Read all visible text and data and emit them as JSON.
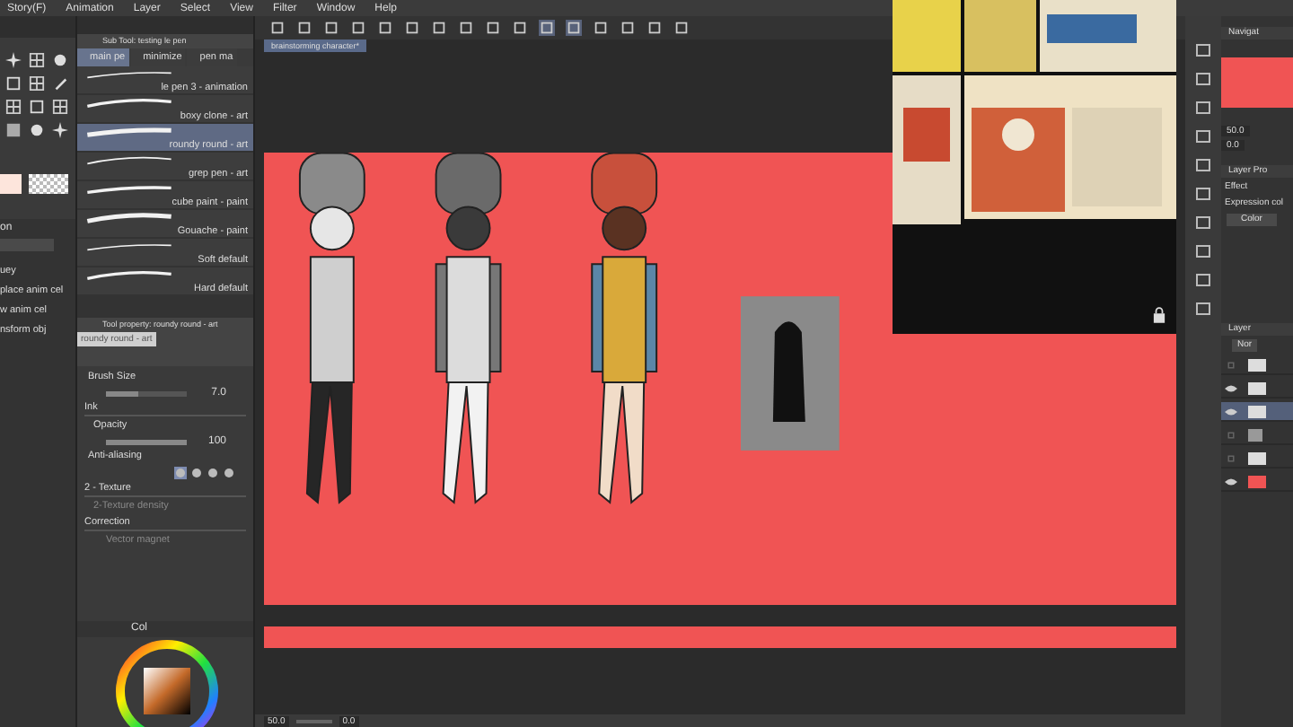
{
  "menu": [
    "Story(F)",
    "Animation",
    "Layer",
    "Select",
    "View",
    "Filter",
    "Window",
    "Help"
  ],
  "left_panel": {
    "header": "on",
    "items": [
      "uey",
      "place anim cel",
      "w anim cel",
      "nsform obj"
    ]
  },
  "sub_tool": {
    "title": "Sub Tool: testing le pen",
    "tabs": [
      {
        "label": "main pe",
        "selected": true
      },
      {
        "label": "minimize",
        "selected": false
      },
      {
        "label": "pen ma",
        "selected": false
      }
    ],
    "brushes": [
      {
        "label": "le pen 3 - animation",
        "selected": false
      },
      {
        "label": "boxy clone - art",
        "selected": false
      },
      {
        "label": "roundy round - art",
        "selected": true
      },
      {
        "label": "grep pen - art",
        "selected": false
      },
      {
        "label": "cube paint - paint",
        "selected": false
      },
      {
        "label": "Gouache - paint",
        "selected": false
      },
      {
        "label": "Soft default",
        "selected": false
      },
      {
        "label": "Hard default",
        "selected": false
      }
    ]
  },
  "tool_property": {
    "title": "Tool property: roundy round - art",
    "preview_label": "roundy round - art",
    "brush_size": {
      "label": "Brush Size",
      "value": "7.0",
      "level": 0.4
    },
    "ink": "Ink",
    "opacity": {
      "label": "Opacity",
      "value": "100",
      "level": 1
    },
    "anti_aliasing": {
      "label": "Anti-aliasing",
      "options": [
        {
          "selected": true
        },
        {
          "selected": false
        },
        {
          "selected": false
        },
        {
          "selected": false
        }
      ]
    },
    "texture": {
      "label": "2 - Texture",
      "density": "2-Texture density"
    },
    "correction": {
      "label": "Correction",
      "vector_magnet": "Vector magnet"
    }
  },
  "color_panel": {
    "tab": "Col"
  },
  "canvas": {
    "tab": "brainstorming character*"
  },
  "status_bar": {
    "zoom": "50.0",
    "angle": "0.0"
  },
  "navigator": {
    "title": "Navigat",
    "zoom": "50.0",
    "angle": "0.0"
  },
  "layer_property": {
    "title": "Layer Pro",
    "effect": "Effect",
    "expression": "Expression col",
    "color_button": "Color"
  },
  "layers": {
    "title": "Layer",
    "blend": "Nor",
    "rows": [
      {
        "kind": "layer",
        "visible": false,
        "selected": false
      },
      {
        "kind": "layer",
        "visible": true,
        "selected": false
      },
      {
        "kind": "layer",
        "visible": true,
        "selected": true
      },
      {
        "kind": "folder",
        "visible": false,
        "selected": false
      },
      {
        "kind": "layer",
        "visible": false,
        "selected": false
      },
      {
        "kind": "paper",
        "visible": true,
        "selected": false,
        "color": "#f05454"
      }
    ]
  }
}
